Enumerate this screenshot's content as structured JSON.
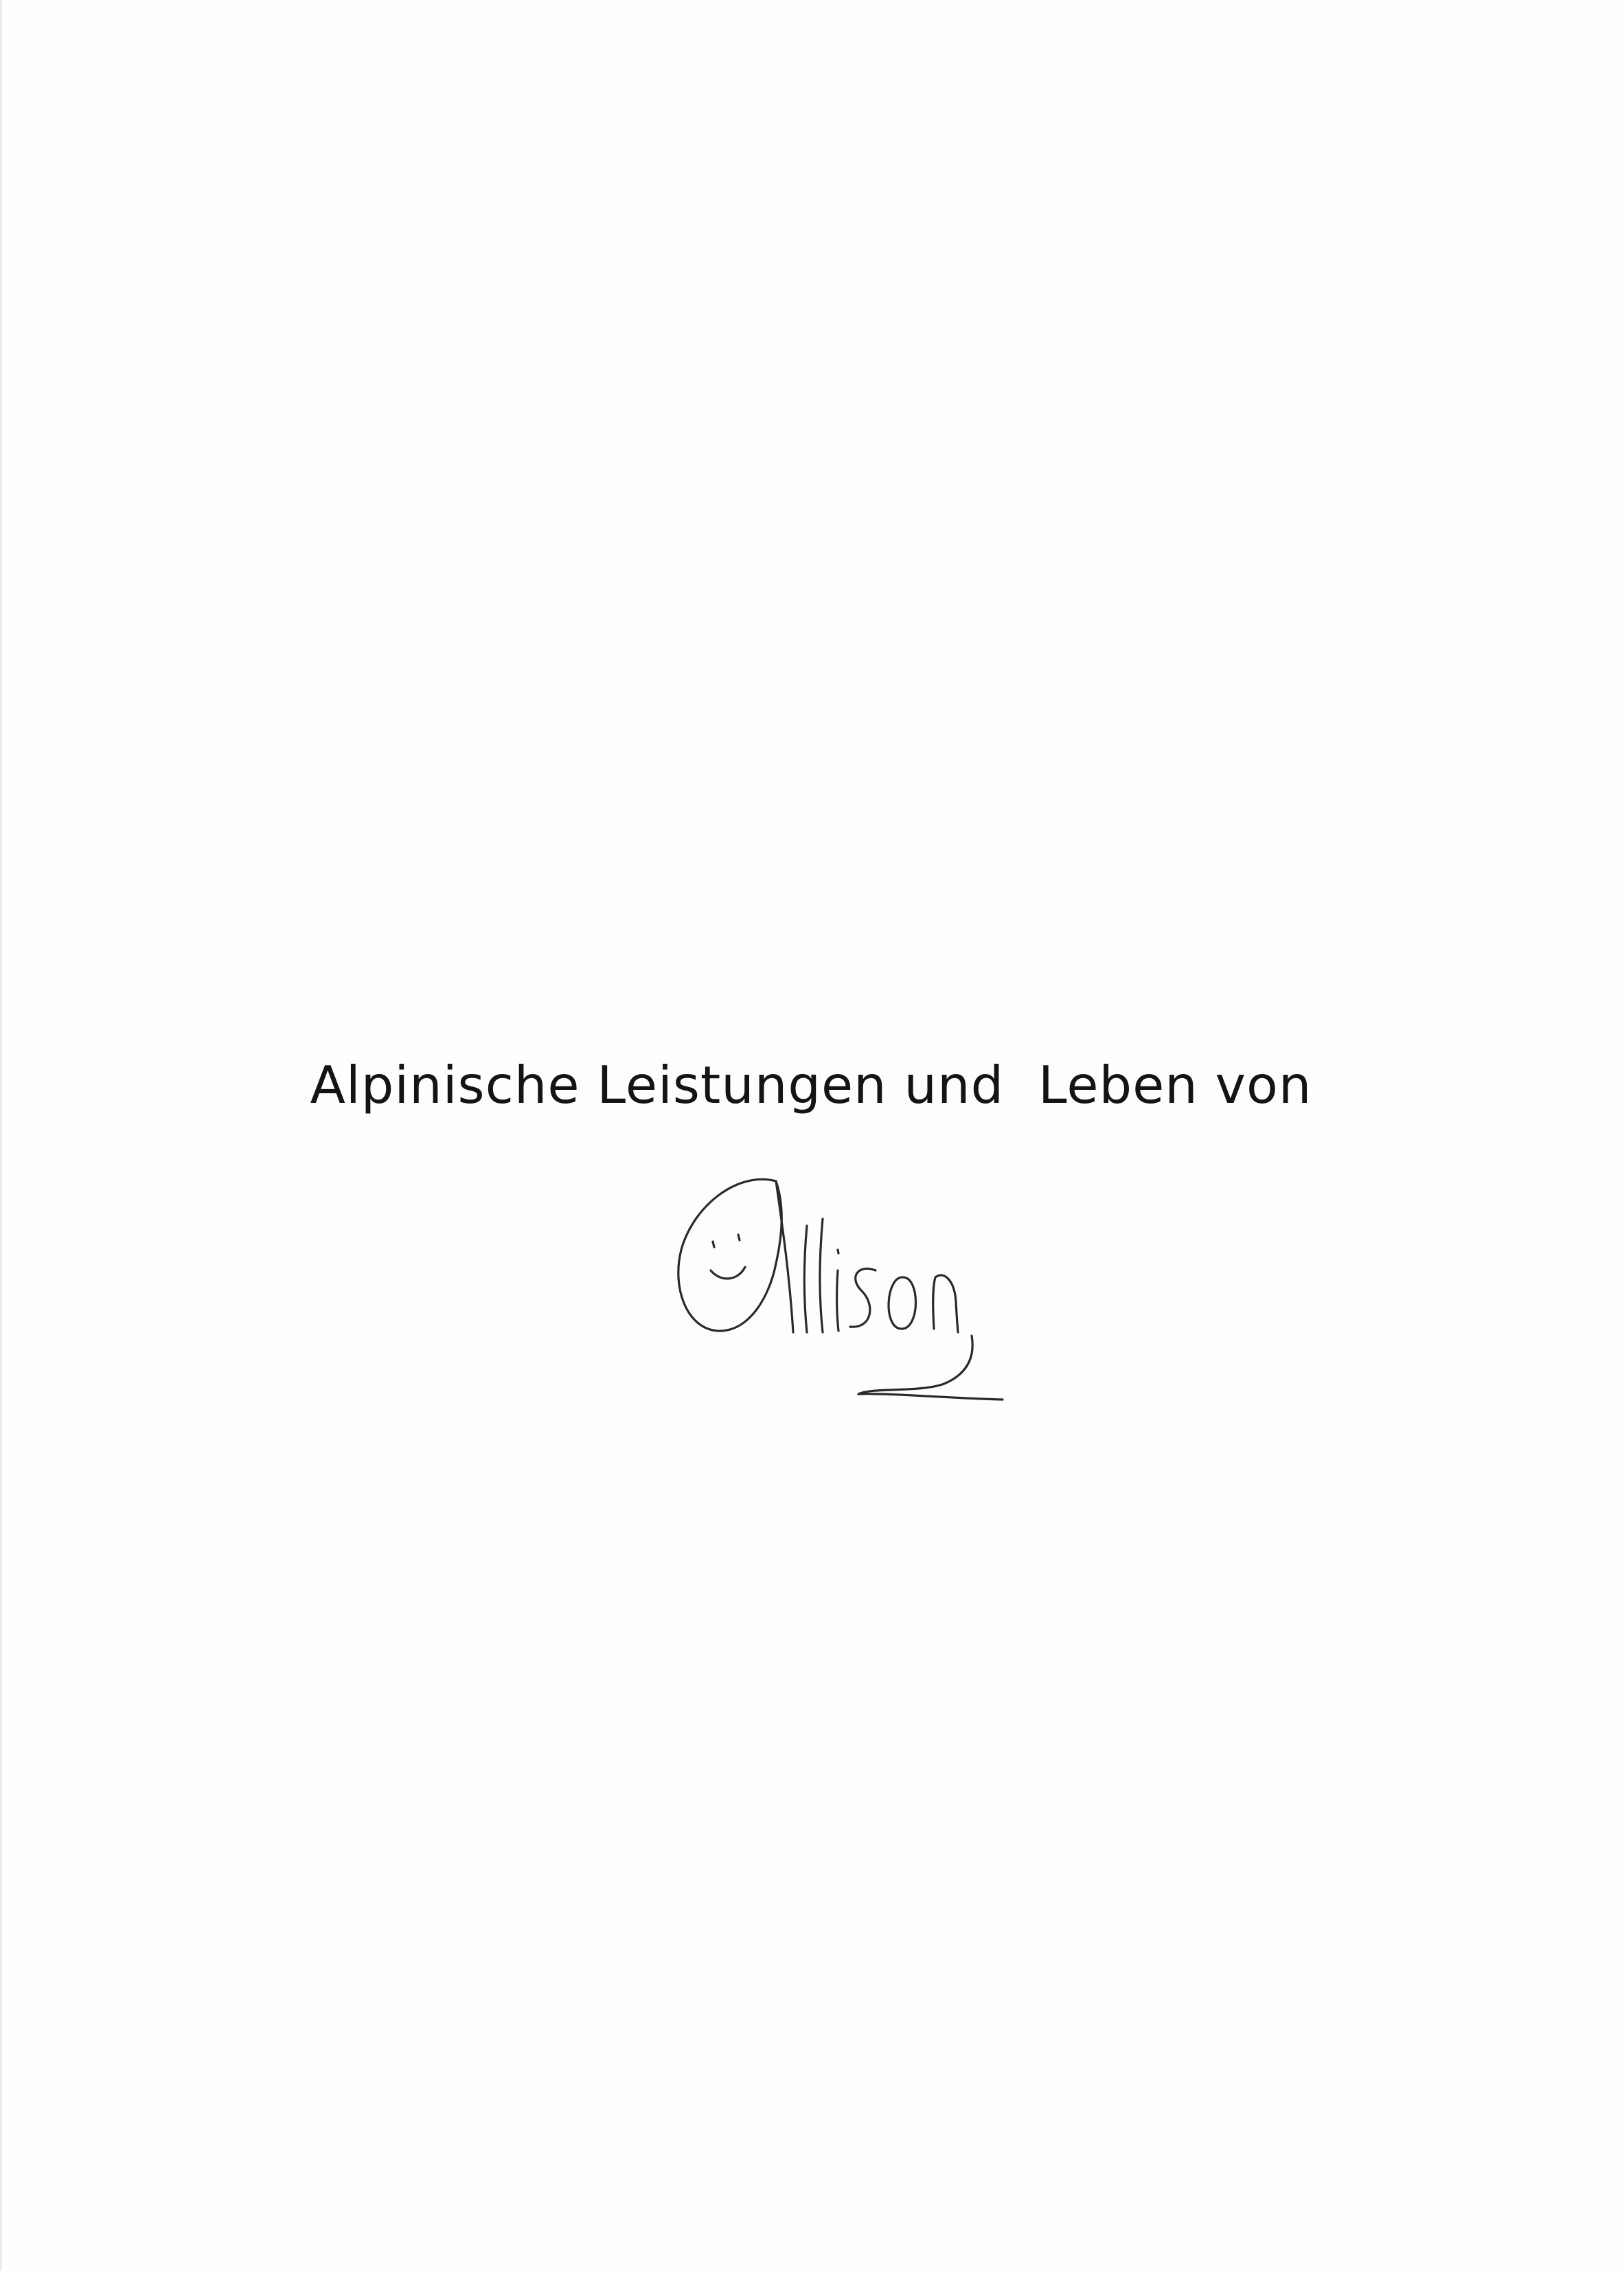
{
  "document": {
    "title": "Alpinische Leistungen und  Leben von",
    "signature_text": "Alison",
    "ink_color": "#2a2a2a"
  }
}
